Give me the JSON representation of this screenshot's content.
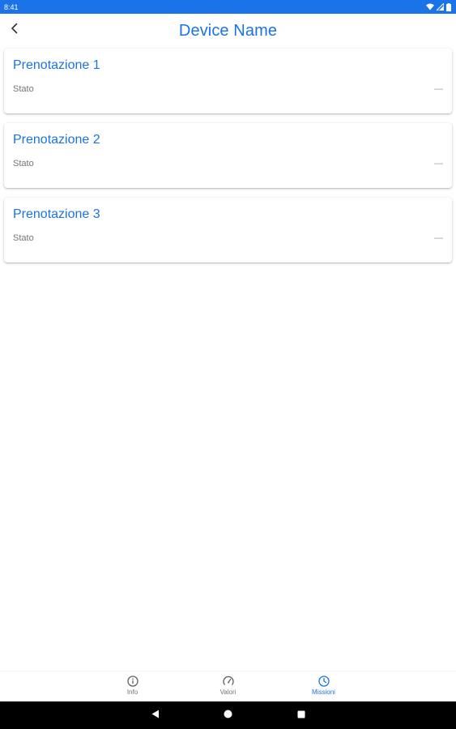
{
  "status_bar": {
    "time": "8:41",
    "icons": [
      "wifi-icon",
      "signal-icon",
      "battery-icon"
    ]
  },
  "app_bar": {
    "title": "Device Name",
    "back_icon": "chevron-left-icon"
  },
  "bookings": [
    {
      "title": "Prenotazione 1",
      "label": "Stato",
      "value": "—"
    },
    {
      "title": "Prenotazione 2",
      "label": "Stato",
      "value": "—"
    },
    {
      "title": "Prenotazione 3",
      "label": "Stato",
      "value": "—"
    }
  ],
  "bottom_nav": {
    "items": [
      {
        "label": "Info",
        "icon": "info-icon",
        "active": false
      },
      {
        "label": "Valori",
        "icon": "speedometer-icon",
        "active": false
      },
      {
        "label": "Missioni",
        "icon": "clock-icon",
        "active": true
      }
    ]
  },
  "system_nav": {
    "buttons": [
      "back-triangle-icon",
      "home-circle-icon",
      "recents-square-icon"
    ]
  },
  "colors": {
    "accent": "#1a73e8",
    "status_bar": "#1a73e8",
    "muted_text": "#757575"
  }
}
